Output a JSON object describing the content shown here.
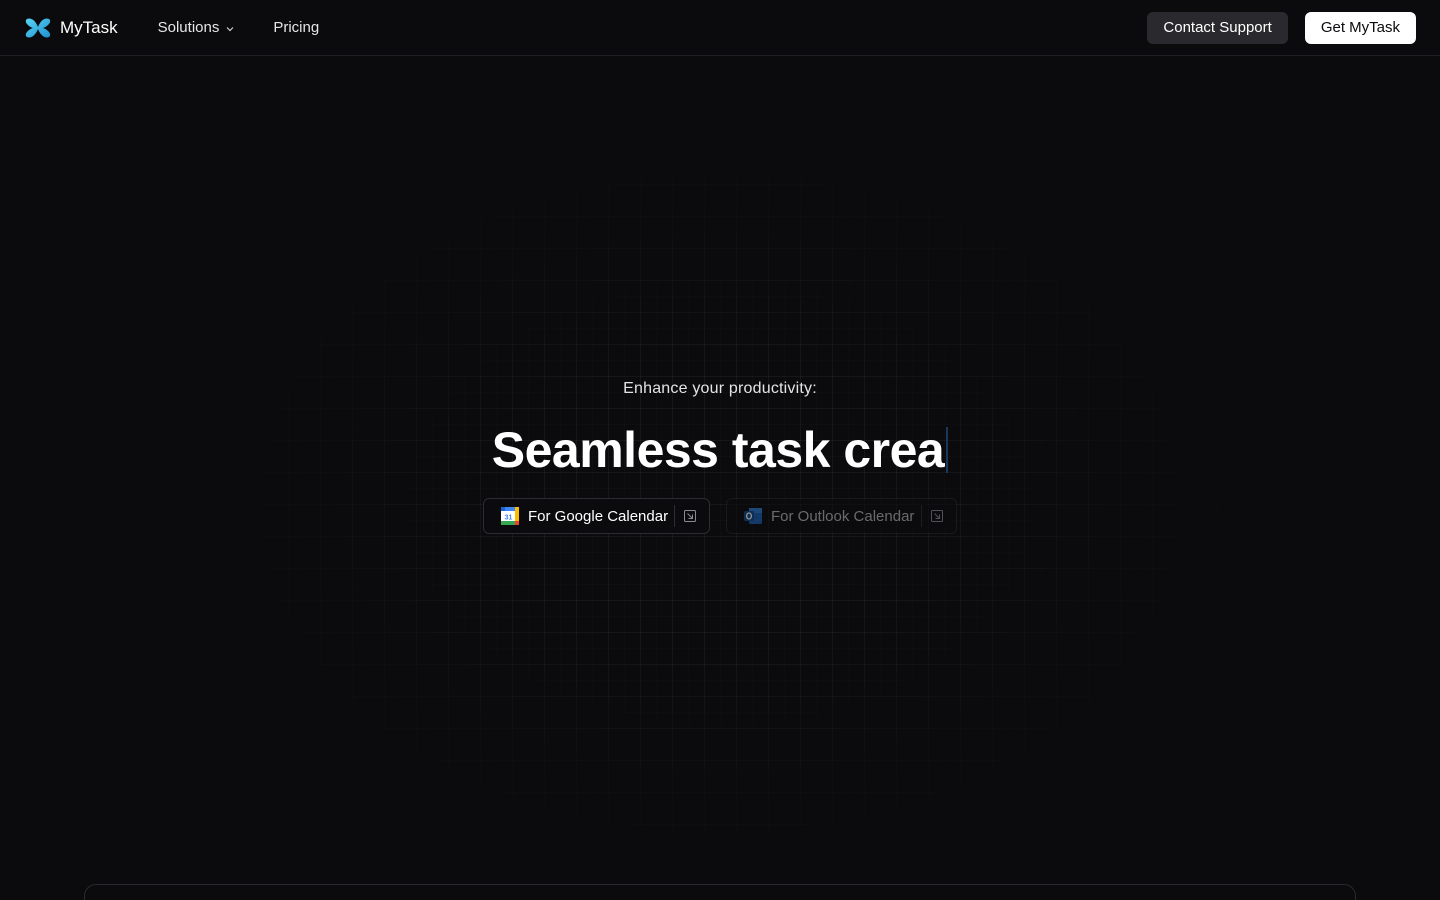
{
  "header": {
    "brand": "MyTask",
    "nav": [
      {
        "label": "Solutions",
        "has_dropdown": true
      },
      {
        "label": "Pricing",
        "has_dropdown": false
      }
    ],
    "contact_label": "Contact Support",
    "get_label": "Get MyTask"
  },
  "hero": {
    "eyebrow": "Enhance your productivity:",
    "headline": "Seamless task crea",
    "ctas": [
      {
        "label": "For Google Calendar",
        "icon": "google-calendar-icon",
        "enabled": true
      },
      {
        "label": "For Outlook Calendar",
        "icon": "outlook-icon",
        "enabled": false
      }
    ]
  },
  "colors": {
    "background": "#0b0b0d",
    "logo_accent": "#2fb6e8",
    "caret": "#16395c",
    "button_primary": "#ffffff",
    "button_secondary": "#2a2a2e"
  }
}
